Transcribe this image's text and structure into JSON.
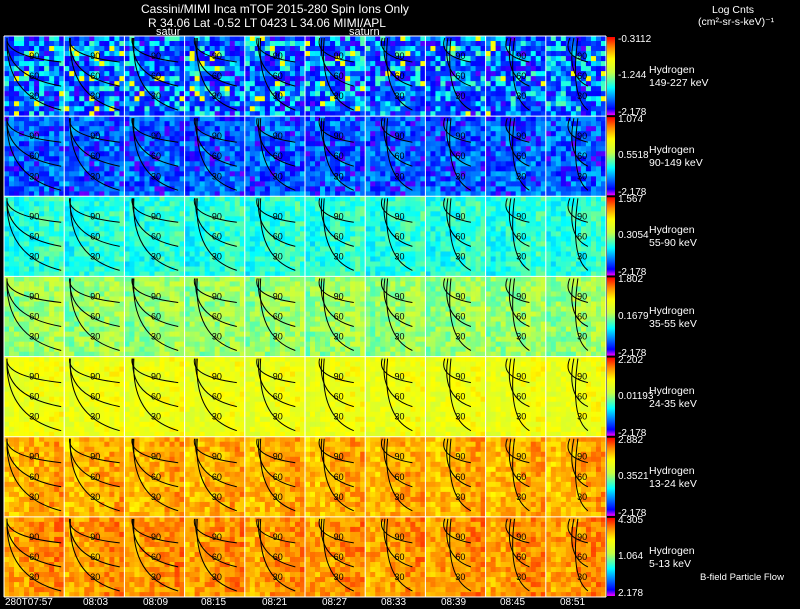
{
  "header": {
    "line1": "Cassini/MIMI Inca mTOF  2015-280   Spin   Ions Only",
    "line2": "R        34.06 Lat -0.52 LT 0423 L         34.06  MIMI/APL",
    "saturn_left": "satur",
    "saturn_mid": "saturn",
    "colorbar_title": "Log Cnts",
    "colorbar_units": "(cm²-sr-s-keV)⁻¹"
  },
  "footer": {
    "flow_label": "B-field Particle Flow"
  },
  "colors": {
    "background": "#000000",
    "grid": "#ffffff",
    "contour": "#000000"
  },
  "chart_data": {
    "type": "heatmap",
    "x_ticks": [
      "280T07:57",
      "08:03",
      "08:09",
      "08:15",
      "08:21",
      "08:27",
      "08:33",
      "08:39",
      "08:45",
      "08:51"
    ],
    "contour_labels": [
      "30",
      "60",
      "90"
    ],
    "rows": [
      {
        "species": "Hydrogen",
        "energy": "149-227 keV",
        "max": "-0.3112",
        "mid": "-1.244",
        "min": "-2.178",
        "level": 0.25
      },
      {
        "species": "Hydrogen",
        "energy": "90-149 keV",
        "max": "1.074",
        "mid": "0.5518",
        "min": "-2.178",
        "level": 0.17
      },
      {
        "species": "Hydrogen",
        "energy": "55-90 keV",
        "max": "1.567",
        "mid": "0.3054",
        "min": "-2.178",
        "level": 0.36
      },
      {
        "species": "Hydrogen",
        "energy": "35-55 keV",
        "max": "1.802",
        "mid": "0.1679",
        "min": "-2.178",
        "level": 0.48
      },
      {
        "species": "Hydrogen",
        "energy": "24-35 keV",
        "max": "2.202",
        "mid": "0.01193",
        "min": "-2.178",
        "level": 0.64
      },
      {
        "species": "Hydrogen",
        "energy": "13-24 keV",
        "max": "2.882",
        "mid": "0.3521",
        "min": "-2.178",
        "level": 0.79
      },
      {
        "species": "Hydrogen",
        "energy": "5-13 keV",
        "max": "4.305",
        "mid": "1.064",
        "min": "2.178",
        "level": 0.82
      }
    ]
  }
}
